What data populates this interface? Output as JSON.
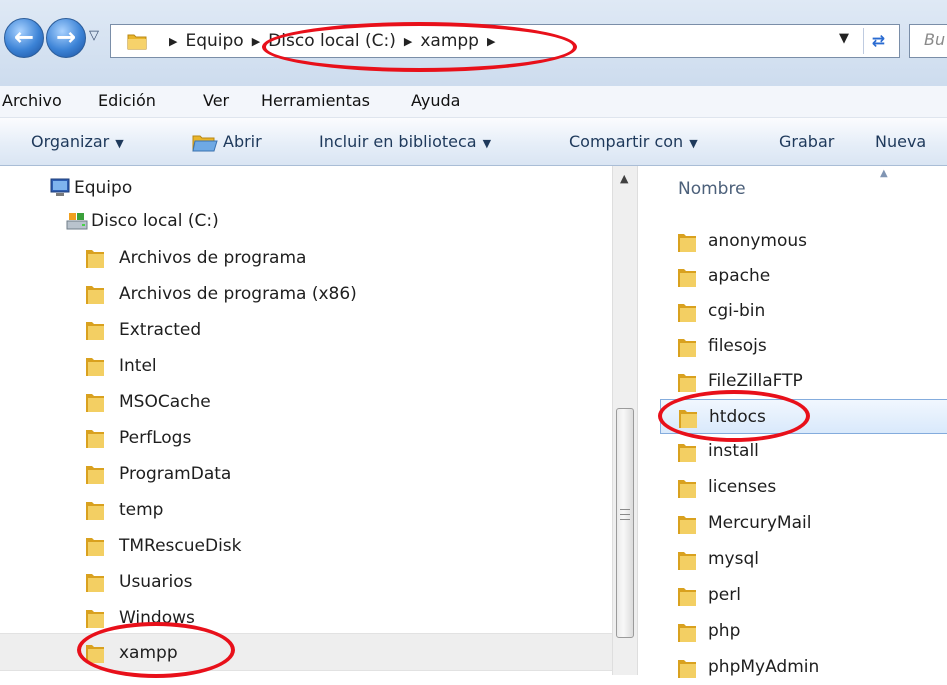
{
  "address_bar": {
    "crumbs": [
      "Equipo",
      "Disco local (C:)",
      "xampp"
    ],
    "search_placeholder": "Bu"
  },
  "menu": [
    "Archivo",
    "Edición",
    "Ver",
    "Herramientas",
    "Ayuda"
  ],
  "toolbar": {
    "organize": "Organizar",
    "open": "Abrir",
    "include": "Incluir en biblioteca",
    "share": "Compartir con",
    "burn": "Grabar",
    "new_folder": "Nueva"
  },
  "nav_tree": {
    "computer": "Equipo",
    "drive": "Disco local (C:)",
    "folders": [
      "Archivos de programa",
      "Archivos de programa (x86)",
      "Extracted",
      "Intel",
      "MSOCache",
      "PerfLogs",
      "ProgramData",
      "temp",
      "TMRescueDisk",
      "Usuarios",
      "Windows",
      "xampp"
    ],
    "selected": "xampp"
  },
  "file_list": {
    "column_name": "Nombre",
    "items": [
      "anonymous",
      "apache",
      "cgi-bin",
      "filesojs",
      "FileZillaFTP",
      "htdocs",
      "install",
      "licenses",
      "MercuryMail",
      "mysql",
      "perl",
      "php",
      "phpMyAdmin"
    ],
    "highlighted": "htdocs"
  },
  "colors": {
    "annotation": "#e8101a",
    "folder": "#e9b52a",
    "selection": "#d9e9fb"
  }
}
